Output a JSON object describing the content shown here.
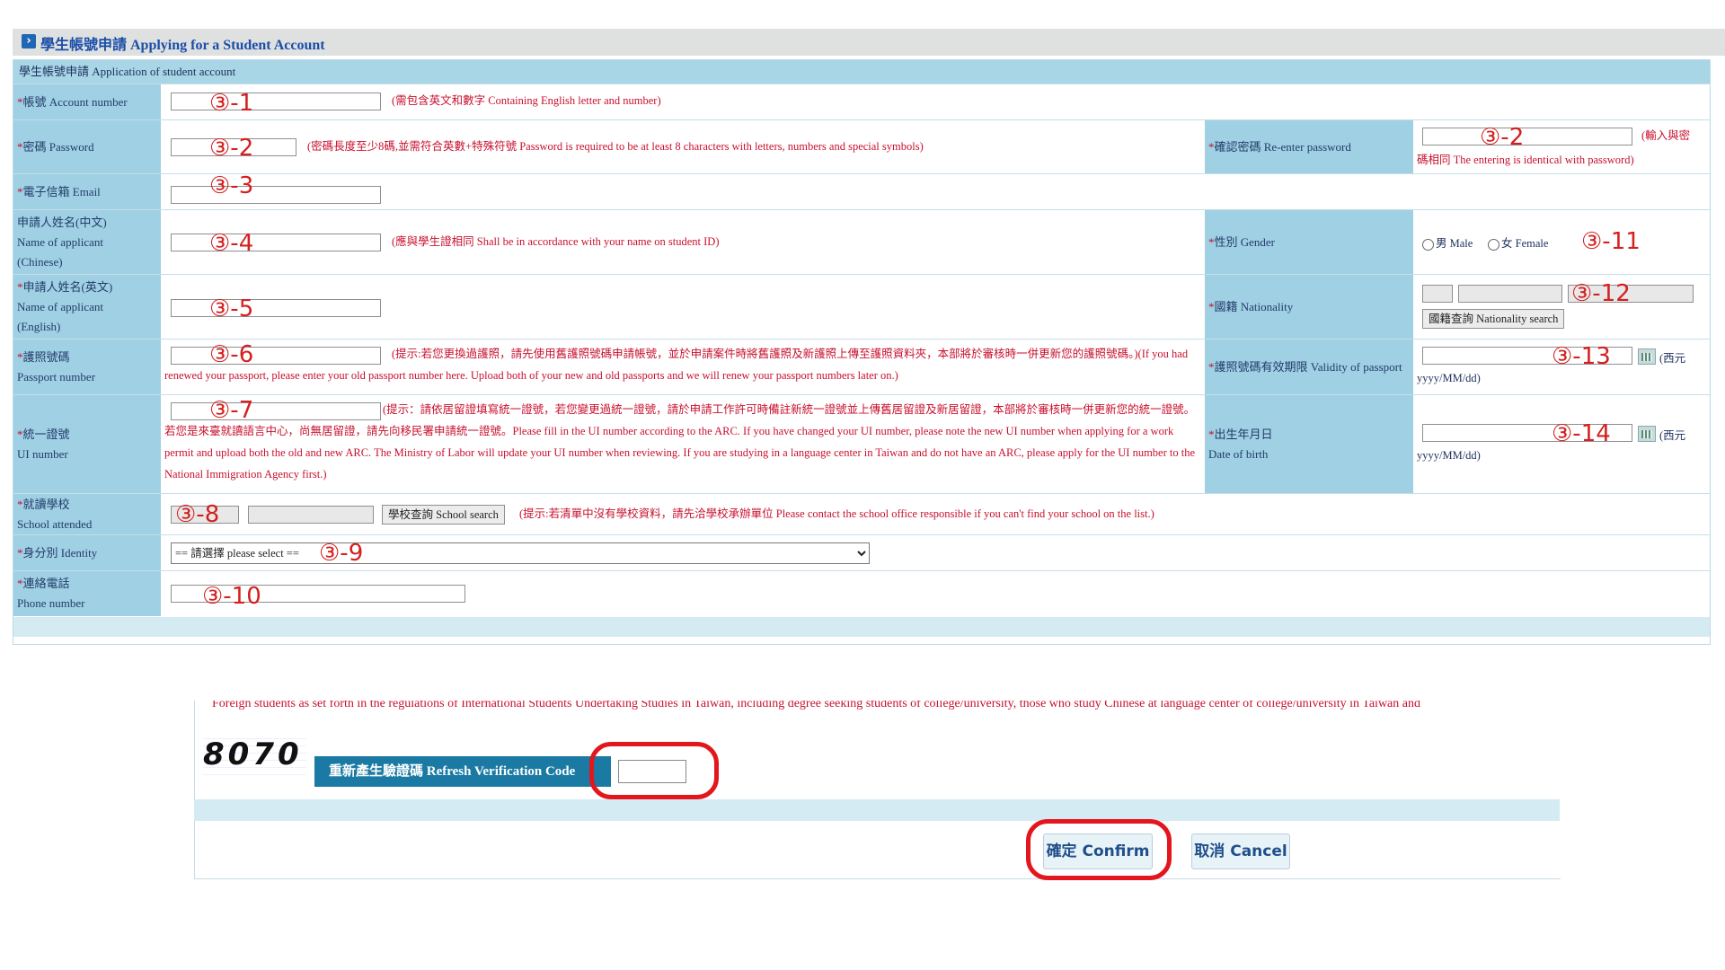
{
  "header": {
    "title": "學生帳號申請 Applying for a Student Account"
  },
  "form": {
    "subtitle": "學生帳號申請 Application of student account",
    "account": {
      "label": "帳號 Account number",
      "hint": "(需包含英文和數字 Containing English letter and number)",
      "marker": "③-1"
    },
    "password": {
      "label": "密碼 Password",
      "hint": "(密碼長度至少8碼,並需符合英數+特殊符號 Password is required to be at least 8 characters with letters, numbers and special symbols)",
      "marker": "③-2"
    },
    "repassword": {
      "label": "確認密碼 Re-enter password",
      "hint_a": "(輸入與密",
      "hint_b": "碼相同 The entering is identical with password)",
      "marker": "③-2"
    },
    "email": {
      "label": "電子信箱 Email",
      "marker": "③-3"
    },
    "name_cn": {
      "label_1": "申請人姓名(中文)",
      "label_2": "Name of applicant",
      "label_3": "(Chinese)",
      "hint": "(應與學生證相同 Shall be in accordance with your name on student ID)",
      "marker": "③-4"
    },
    "gender": {
      "label": "性別 Gender",
      "male": "男 Male",
      "female": "女 Female",
      "marker": "③-11"
    },
    "name_en": {
      "label_1": "申請人姓名(英文)",
      "label_2": "Name of applicant",
      "label_3": "(English)",
      "marker": "③-5"
    },
    "nationality": {
      "label": "國籍 Nationality",
      "search_button": "國籍查詢 Nationality search",
      "marker": "③-12"
    },
    "passport": {
      "label_1": "護照號碼",
      "label_2": "Passport number",
      "hint": "(提示:若您更換過護照，請先使用舊護照號碼申請帳號，並於申請案件時將舊護照及新護照上傳至護照資料夾，本部將於審核時一併更新您的護照號碼。)(If you had renewed your passport, please enter your old passport number here. Upload both of your new and old passports and we will renew your passport numbers later on.)",
      "marker": "③-6"
    },
    "passport_validity": {
      "label": "護照號碼有效期限 Validity of passport",
      "era": "(西元",
      "format": "yyyy/MM/dd)",
      "marker": "③-13"
    },
    "ui_number": {
      "label_1": "統一證號",
      "label_2": "UI number",
      "hint": "(提示：請依居留證填寫統一證號，若您變更過統一證號，請於申請工作許可時備註新統一證號並上傳舊居留證及新居留證，本部將於審核時一併更新您的統一證號。若您是來臺就讀語言中心，尚無居留證，請先向移民署申請統一證號。Please fill in the UI number according to the ARC. If you have changed your UI number, please note the new UI number when applying for a work permit and upload both the old and new ARC. The Ministry of Labor will update your UI number when reviewing. If you are studying in a language center in Taiwan and do not have an ARC, please apply for the UI number to the National Immigration Agency first.)",
      "marker": "③-7"
    },
    "birth": {
      "label_1": "出生年月日",
      "label_2": "Date of birth",
      "era": "(西元",
      "format": "yyyy/MM/dd)",
      "marker": "③-14"
    },
    "school": {
      "label_1": "就讀學校",
      "label_2": "School attended",
      "search_button": "學校查詢 School search",
      "hint": "(提示:若清單中沒有學校資料，請先洽學校承辦單位 Please contact the school office responsible if you can't find your school on the list.)",
      "marker": "③-8"
    },
    "identity": {
      "label": "身分別 Identity",
      "selected": "== 請選擇 please select ==",
      "marker": "③-9"
    },
    "phone": {
      "label_1": "連絡電話",
      "label_2": "Phone number",
      "marker": "③-10"
    },
    "required_mark": "*"
  },
  "lower": {
    "hint": "Foreign students as set forth in the regulations of International Students Undertaking Studies in Taiwan, including degree seeking students of college/university, those who study Chinese at language center of college/university in Taiwan and",
    "captcha": "8070",
    "refresh_button": "重新產生驗證碼 Refresh Verification Code",
    "confirm_button": "確定 Confirm",
    "cancel_button": "取消 Cancel"
  },
  "colors": {
    "label_bg": "#9fd0e3",
    "hint_red": "#c8102e",
    "marker_red": "#d4201f",
    "header_blue": "#1a4ea8"
  }
}
